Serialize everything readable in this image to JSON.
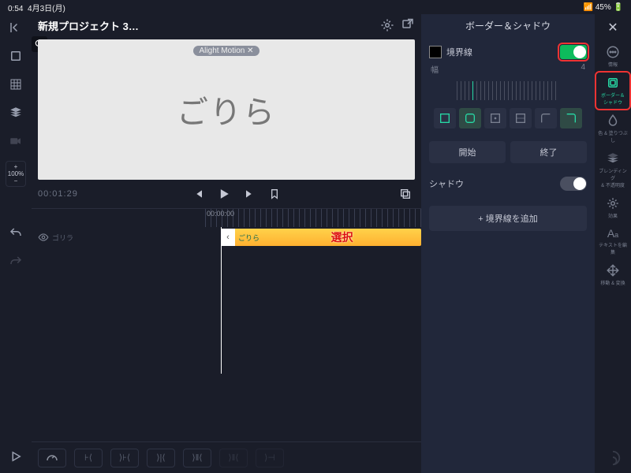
{
  "statusbar": {
    "time": "0:54",
    "date": "4月3日(月)",
    "battery": "45%"
  },
  "header": {
    "project_title": "新規プロジェクト 3…"
  },
  "preview": {
    "watermark": "Alight Motion ✕",
    "text": "ごりら"
  },
  "transport": {
    "timecode": "00:01:29",
    "ruler_start": "00:00:00"
  },
  "leftcol": {
    "zoom": "100%"
  },
  "timeline": {
    "track_label": "ゴリラ",
    "clip_name": "ごりら",
    "overlay": "選択"
  },
  "panel": {
    "title": "ボーダー＆シャドウ",
    "border_label": "境界線",
    "width_label": "幅",
    "width_value": "4",
    "start": "開始",
    "end": "終了",
    "shadow_label": "シャドウ",
    "add": "+ 境界線を追加"
  },
  "rightcol": {
    "info": "情報",
    "border_shadow": "ボーダー＆\nシャドウ",
    "fill": "色 & 塗りつぶし",
    "blend": "ブレンディング\n& 不透明度",
    "effects": "効果",
    "edit_text": "テキストを編集",
    "transform": "移動 & 変換"
  }
}
